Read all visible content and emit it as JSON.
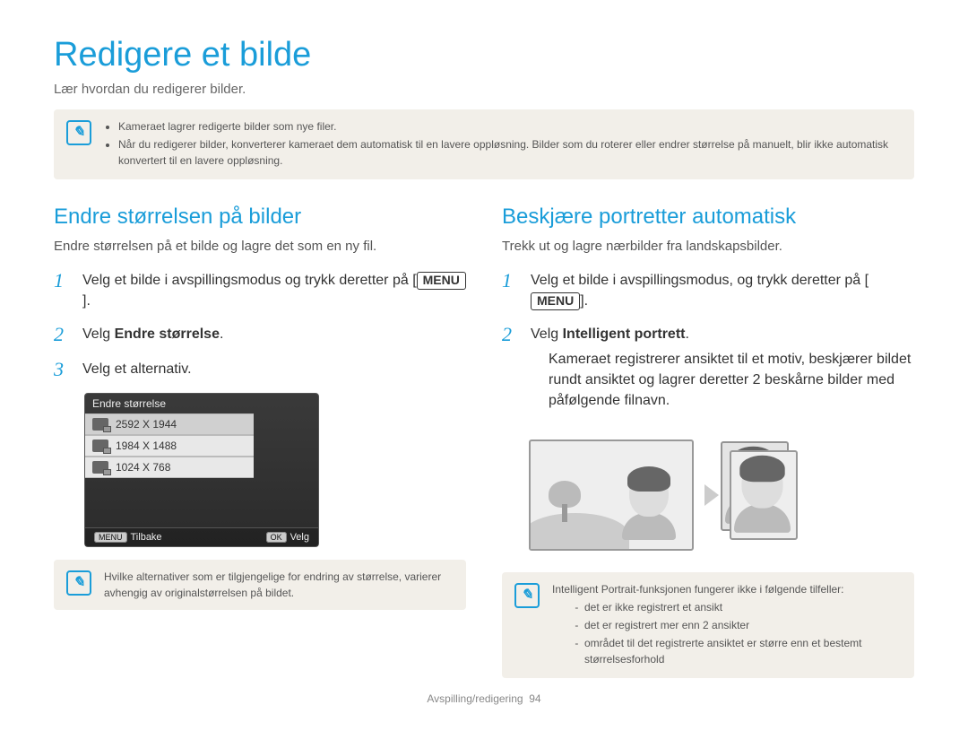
{
  "title": "Redigere et bilde",
  "subtitle": "Lær hvordan du redigerer bilder.",
  "top_note": {
    "items": [
      "Kameraet lagrer redigerte bilder som nye filer.",
      "Når du redigerer bilder, konverterer kameraet dem automatisk til en lavere oppløsning. Bilder som du roterer eller endrer størrelse på manuelt, blir ikke automatisk konvertert til en lavere oppløsning."
    ]
  },
  "left": {
    "heading": "Endre størrelsen på bilder",
    "sub": "Endre størrelsen på et bilde og lagre det som en ny fil.",
    "step1_pre": "Velg et bilde i avspillingsmodus og trykk deretter på [",
    "menu_chip": "MENU",
    "step1_post": "].",
    "step2_pre": "Velg ",
    "step2_bold": "Endre størrelse",
    "step2_post": ".",
    "step3": "Velg et alternativ.",
    "screen": {
      "title": "Endre størrelse",
      "options": [
        "2592 X 1944",
        "1984 X 1488",
        "1024 X 768"
      ],
      "back_btn": "MENU",
      "back_label": "Tilbake",
      "ok_btn": "OK",
      "ok_label": "Velg"
    },
    "note": "Hvilke alternativer som er tilgjengelige for endring av størrelse, varierer avhengig av originalstørrelsen på bildet."
  },
  "right": {
    "heading": "Beskjære portretter automatisk",
    "sub": "Trekk ut og lagre nærbilder fra landskapsbilder.",
    "step1_pre": "Velg et bilde i avspillingsmodus, og trykk deretter på [",
    "menu_chip": "MENU",
    "step1_post": "].",
    "step2_pre": "Velg ",
    "step2_bold": "Intelligent portrett",
    "step2_post": ".",
    "bullet": "Kameraet registrerer ansiktet til et motiv, beskjærer bildet rundt ansiktet og lagrer deretter 2 beskårne bilder med påfølgende filnavn.",
    "note_lead": "Intelligent Portrait-funksjonen fungerer ikke i følgende tilfeller:",
    "note_items": [
      "det er ikke registrert et ansikt",
      "det er registrert mer enn 2 ansikter",
      "området til det registrerte ansiktet er større enn et bestemt størrelsesforhold"
    ]
  },
  "footer_section": "Avspilling/redigering",
  "footer_page": "94"
}
